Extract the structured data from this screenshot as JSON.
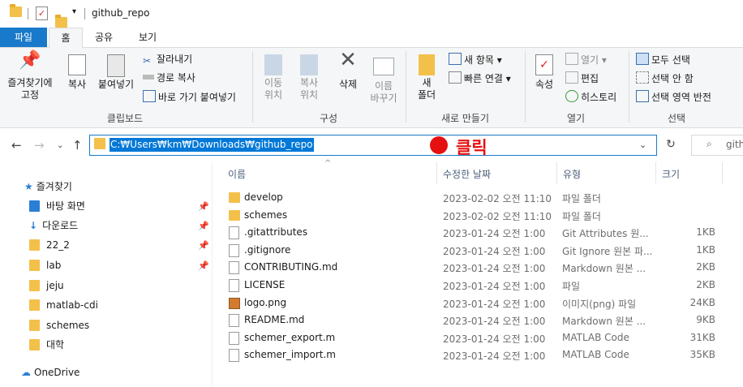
{
  "window": {
    "title": "github_repo"
  },
  "menu": {
    "file": "파일",
    "home": "홈",
    "share": "공유",
    "view": "보기"
  },
  "ribbon": {
    "clipboard": {
      "pin": "즐겨찾기에\n고정",
      "copy": "복사",
      "paste": "붙여넣기",
      "cut": "잘라내기",
      "copy_path": "경로 복사",
      "paste_shortcut": "바로 가기 붙여넣기",
      "label": "클립보드"
    },
    "organize": {
      "move_to": "이동\n위치",
      "copy_to": "복사\n위치",
      "delete": "삭제",
      "rename": "이름\n바꾸기",
      "label": "구성"
    },
    "new": {
      "new_folder": "새\n폴더",
      "new_item": "새 항목",
      "easy_access": "빠른 연결",
      "label": "새로 만들기"
    },
    "open": {
      "properties": "속성",
      "open": "열기",
      "edit": "편집",
      "history": "히스토리",
      "label": "열기"
    },
    "select": {
      "select_all": "모두 선택",
      "select_none": "선택 안 함",
      "invert": "선택 영역 반전",
      "label": "선택"
    }
  },
  "address": {
    "path": "C:₩Users₩km₩Downloads₩github_repo",
    "annotation": "클릭",
    "search_placeholder": "gith"
  },
  "nav": {
    "quick_access": "즐겨찾기",
    "items": [
      {
        "label": "바탕 화면",
        "pinned": true
      },
      {
        "label": "다운로드",
        "pinned": true
      },
      {
        "label": "22_2",
        "pinned": true
      },
      {
        "label": "lab",
        "pinned": true
      },
      {
        "label": "jeju",
        "pinned": false
      },
      {
        "label": "matlab-cdi",
        "pinned": false
      },
      {
        "label": "schemes",
        "pinned": false
      },
      {
        "label": "대학",
        "pinned": false
      }
    ],
    "onedrive": "OneDrive"
  },
  "columns": {
    "name": "이름",
    "modified": "수정한 날짜",
    "type": "유형",
    "size": "크기"
  },
  "files": [
    {
      "name": "develop",
      "modified": "2023-02-02 오전 11:10",
      "type": "파일 폴더",
      "size": "",
      "kind": "folder"
    },
    {
      "name": "schemes",
      "modified": "2023-02-02 오전 11:10",
      "type": "파일 폴더",
      "size": "",
      "kind": "folder"
    },
    {
      "name": ".gitattributes",
      "modified": "2023-01-24 오전 1:00",
      "type": "Git Attributes 원...",
      "size": "1KB",
      "kind": "file"
    },
    {
      "name": ".gitignore",
      "modified": "2023-01-24 오전 1:00",
      "type": "Git Ignore 원본 파...",
      "size": "1KB",
      "kind": "file"
    },
    {
      "name": "CONTRIBUTING.md",
      "modified": "2023-01-24 오전 1:00",
      "type": "Markdown 원본 ...",
      "size": "2KB",
      "kind": "file"
    },
    {
      "name": "LICENSE",
      "modified": "2023-01-24 오전 1:00",
      "type": "파일",
      "size": "2KB",
      "kind": "file"
    },
    {
      "name": "logo.png",
      "modified": "2023-01-24 오전 1:00",
      "type": "이미지(png) 파일",
      "size": "24KB",
      "kind": "image"
    },
    {
      "name": "README.md",
      "modified": "2023-01-24 오전 1:00",
      "type": "Markdown 원본 ...",
      "size": "9KB",
      "kind": "file"
    },
    {
      "name": "schemer_export.m",
      "modified": "2023-01-24 오전 1:00",
      "type": "MATLAB Code",
      "size": "31KB",
      "kind": "file"
    },
    {
      "name": "schemer_import.m",
      "modified": "2023-01-24 오전 1:00",
      "type": "MATLAB Code",
      "size": "35KB",
      "kind": "file"
    }
  ]
}
